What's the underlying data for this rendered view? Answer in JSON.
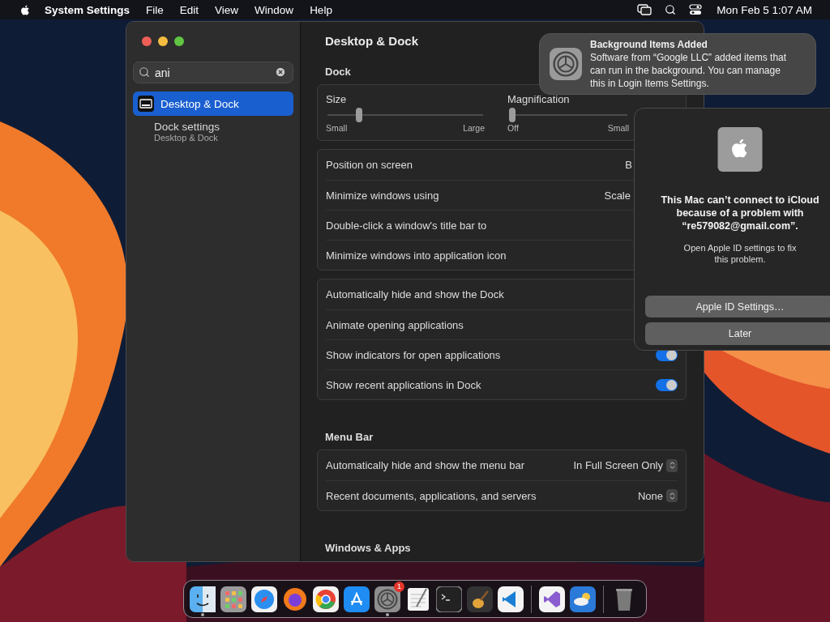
{
  "menu_bar": {
    "app_name": "System Settings",
    "menus": [
      "File",
      "Edit",
      "View",
      "Window",
      "Help"
    ],
    "clock": "Mon Feb 5  1:07 AM"
  },
  "settings_window": {
    "search": {
      "value": "ani"
    },
    "sidebar": {
      "items": [
        {
          "kind": "pane",
          "label": "Desktop & Dock",
          "selected": true
        },
        {
          "kind": "setting",
          "label": "Dock settings",
          "subtitle": "Desktop & Dock",
          "selected": false
        }
      ]
    },
    "title": "Desktop & Dock",
    "sections": [
      {
        "heading": "Dock",
        "groups": [
          {
            "kind": "sliders",
            "sliders": [
              {
                "label": "Size",
                "level": 0.19,
                "labels": [
                  "Small",
                  "Large"
                ]
              },
              {
                "label": "Magnification",
                "level": 0,
                "labels": [
                  "Off",
                  "Small"
                ]
              }
            ]
          },
          {
            "kind": "rows",
            "rows": [
              {
                "kind": "value",
                "label": "Position on screen",
                "value": "B"
              },
              {
                "kind": "value",
                "label": "Minimize windows using",
                "value": "Scale"
              },
              {
                "kind": "covered",
                "label": "Double-click a window's title bar to"
              },
              {
                "kind": "covered",
                "label": "Minimize windows into application icon"
              }
            ]
          },
          {
            "kind": "rows",
            "rows": [
              {
                "kind": "covered",
                "label": "Automatically hide and show the Dock"
              },
              {
                "kind": "covered",
                "label": "Animate opening applications"
              },
              {
                "kind": "toggle",
                "label": "Show indicators for open applications",
                "on": true
              },
              {
                "kind": "toggle",
                "label": "Show recent applications in Dock",
                "on": true
              }
            ]
          }
        ]
      },
      {
        "heading": "Menu Bar",
        "groups": [
          {
            "kind": "rows",
            "rows": [
              {
                "kind": "popup",
                "label": "Automatically hide and show the menu bar",
                "value": "In Full Screen Only"
              },
              {
                "kind": "popup",
                "label": "Recent documents, applications, and servers",
                "value": "None"
              }
            ]
          }
        ]
      },
      {
        "heading": "Windows & Apps"
      }
    ]
  },
  "notification": {
    "title": "Background Items Added",
    "body": "Software from “Google LLC” added items that can run in the background. You can manage this in Login Items Settings."
  },
  "dialog": {
    "title": "This Mac can’t connect to iCloud because of a problem with “re579082@gmail.com”.",
    "message": "Open Apple ID settings to fix this problem.",
    "buttons": [
      "Apple ID Settings…",
      "Later"
    ]
  },
  "dock": {
    "items": [
      {
        "kind": "finder",
        "running": true
      },
      {
        "kind": "launchpad",
        "running": false
      },
      {
        "kind": "safari",
        "running": false
      },
      {
        "kind": "firefox",
        "running": false
      },
      {
        "kind": "chrome",
        "running": false
      },
      {
        "kind": "appstore",
        "running": false
      },
      {
        "kind": "settings",
        "running": true,
        "badge": "1"
      },
      {
        "kind": "textedit",
        "running": false
      },
      {
        "kind": "terminal",
        "running": false
      },
      {
        "kind": "garageband",
        "running": false
      },
      {
        "kind": "vscode",
        "running": false
      },
      {
        "kind": "separator"
      },
      {
        "kind": "visualstudio",
        "running": false
      },
      {
        "kind": "weather",
        "running": false
      },
      {
        "kind": "separator"
      },
      {
        "kind": "trash",
        "running": false
      }
    ]
  }
}
